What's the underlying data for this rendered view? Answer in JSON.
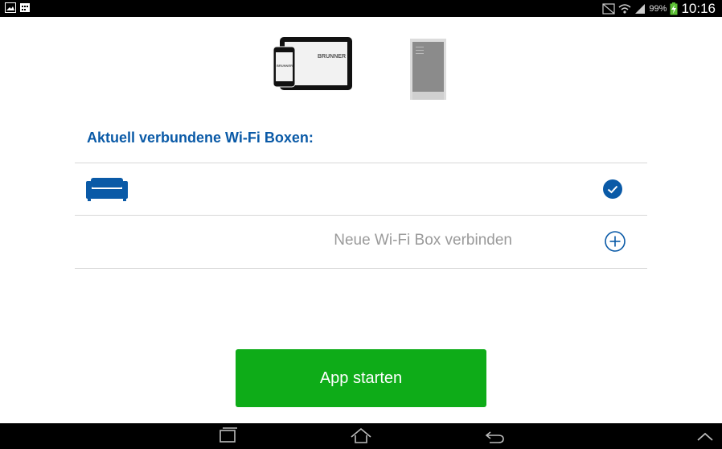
{
  "status_bar": {
    "battery_percent": "99%",
    "time": "10:16",
    "icons": [
      "gallery-icon",
      "calendar-icon",
      "mute-icon",
      "wifi-icon",
      "signal-icon",
      "battery-charging-icon"
    ]
  },
  "header_images": {
    "tablet_brand": "BRUNNER",
    "phone_brand": "BRUNNER"
  },
  "section": {
    "title": "Aktuell verbundene Wi-Fi Boxen:"
  },
  "boxes": [
    {
      "icon": "sofa-icon",
      "status": "connected"
    }
  ],
  "connect_row": {
    "label": "Neue Wi-Fi Box verbinden",
    "icon": "plus-circle-icon"
  },
  "primary_button": {
    "label": "App starten"
  },
  "nav_bar": {
    "buttons": [
      "recent-apps-icon",
      "home-icon",
      "back-icon",
      "chevron-up-icon"
    ]
  },
  "colors": {
    "accent_blue": "#0a5aa7",
    "button_green": "#0eac18",
    "divider": "#d7d7d7"
  }
}
